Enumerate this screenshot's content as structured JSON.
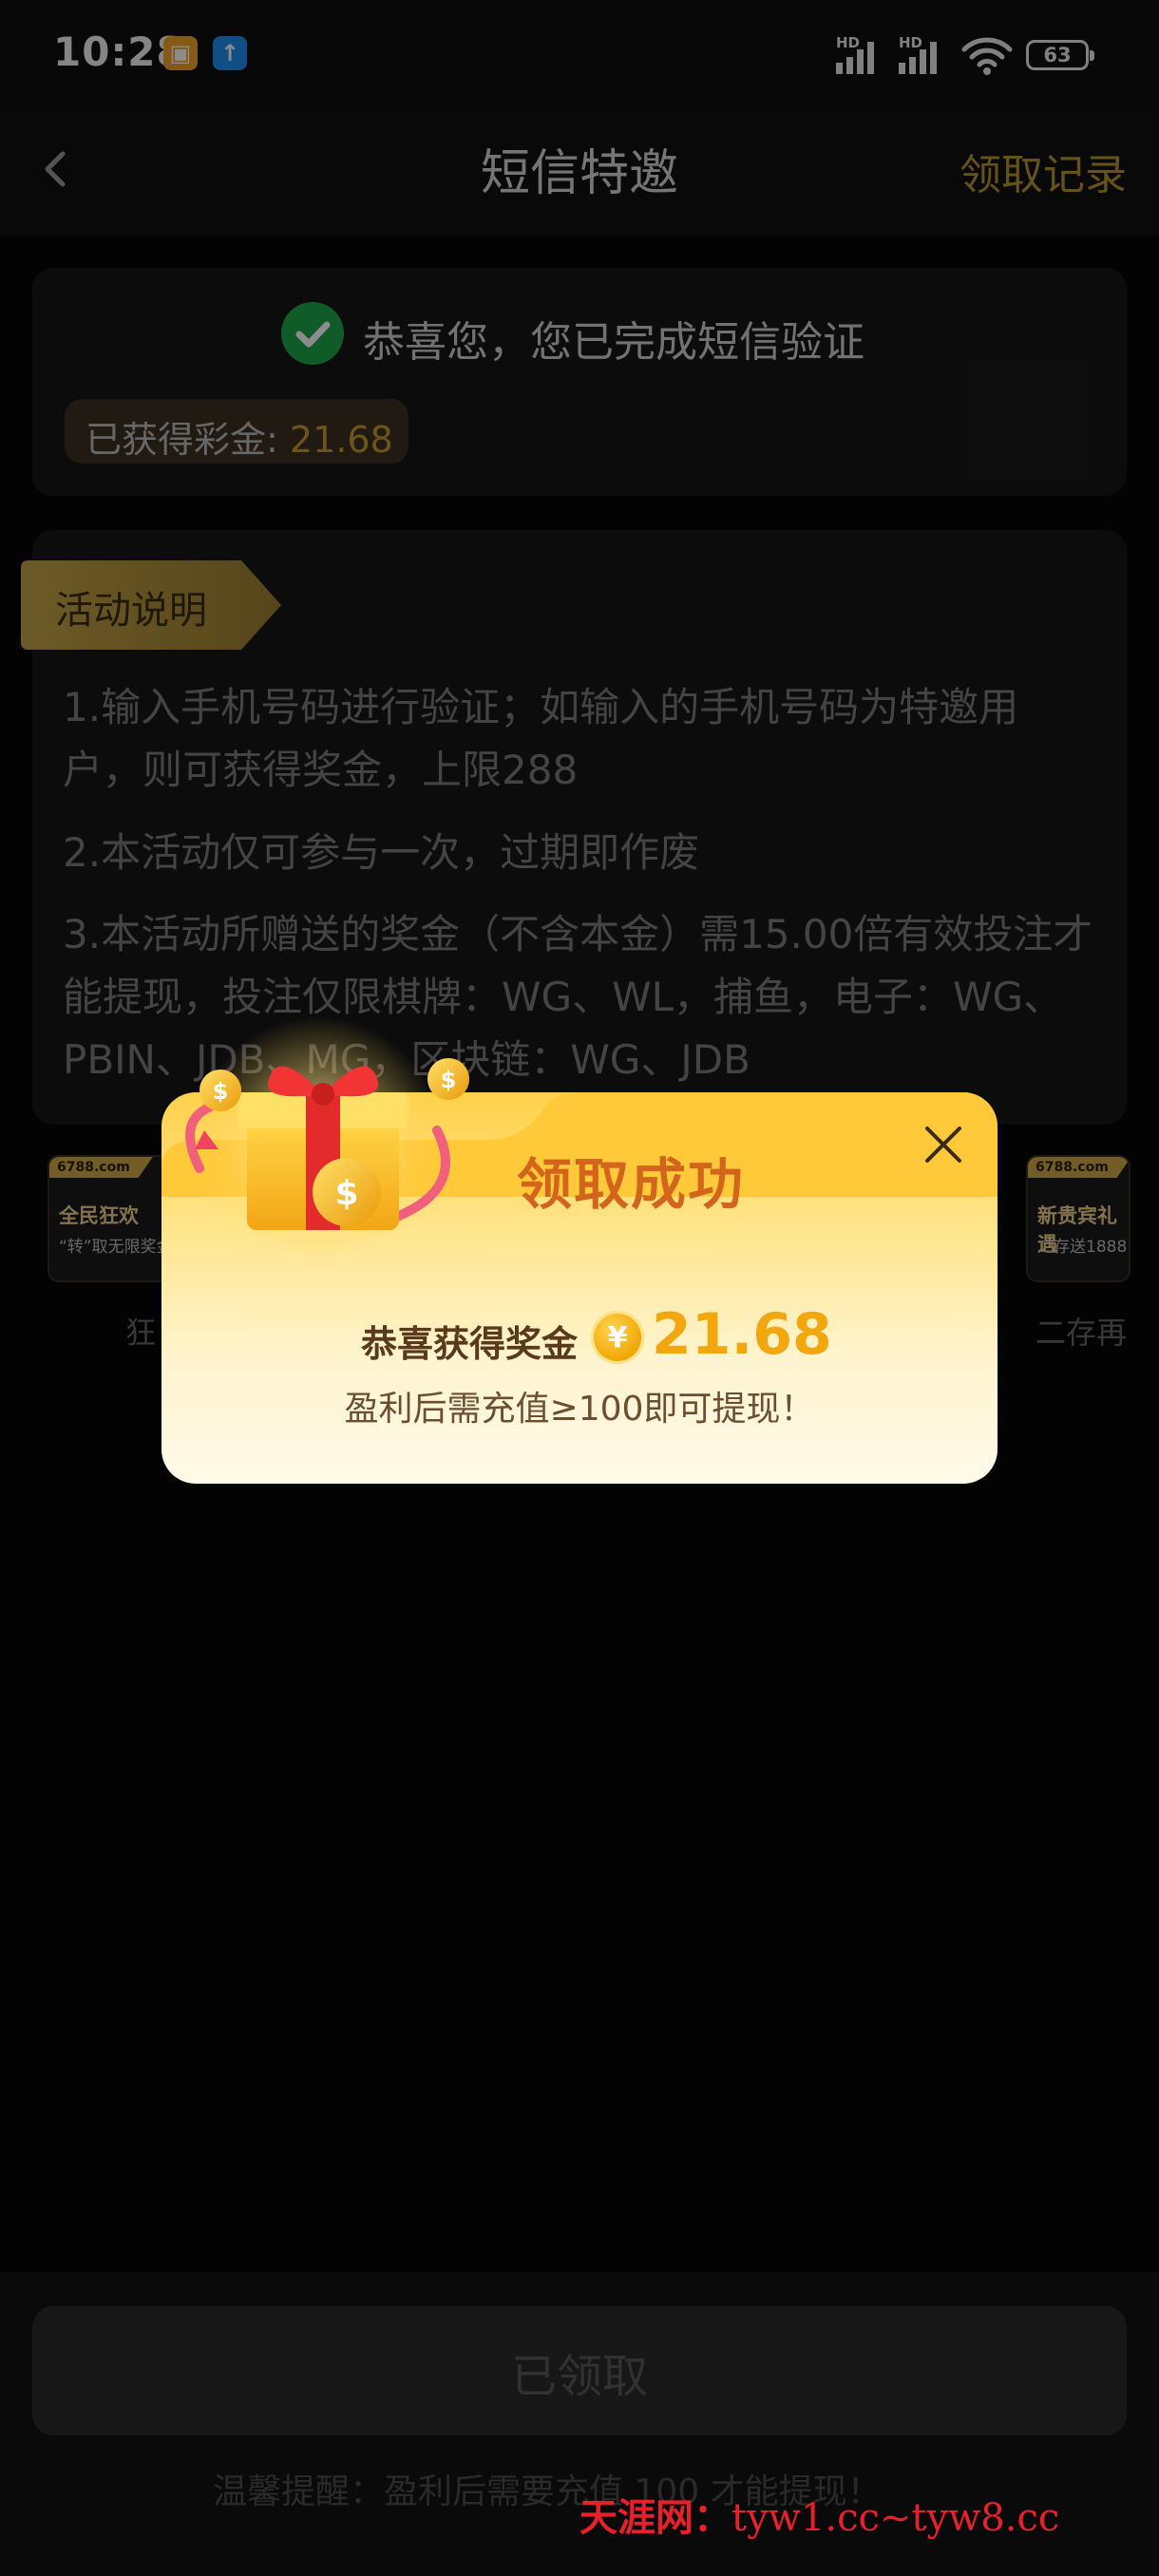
{
  "status_bar": {
    "time": "10:28",
    "signal_label": "HD",
    "battery": "63"
  },
  "header": {
    "title": "短信特邀",
    "records_label": "领取记录"
  },
  "verification": {
    "message": "恭喜您，您已完成短信验证",
    "bonus_label": "已获得彩金: ",
    "bonus_value": "21.68"
  },
  "rules": {
    "tag": "活动说明",
    "items": [
      "1.输入手机号码进行验证；如输入的手机号码为特邀用户，则可获得奖金，上限288",
      "2.本活动仅可参与一次，过期即作废",
      "3.本活动所赠送的奖金（不含本金）需15.00倍有效投注才能提现，投注仅限棋牌：WG、WL，捕鱼，电子：WG、PBIN、JDB、MG，区块链：WG、JDB"
    ]
  },
  "banners": [
    {
      "site": "6788.com",
      "title": "全民狂欢",
      "subtitle": "“转”取无限奖金",
      "caption": "狂"
    },
    {
      "site": "6788.com",
      "title": "新贵宾礼遇",
      "subtitle": "二存送1888",
      "caption": "二存再"
    }
  ],
  "modal": {
    "title": "领取成功",
    "reward_label": "恭喜获得奖金",
    "coin_symbol": "¥",
    "reward_amount": "21.68",
    "note": "盈利后需充值≥100即可提现！"
  },
  "footer": {
    "button_label": "已领取",
    "tip": "温馨提醒：盈利后需要充值 100 才能提现！",
    "watermark_cn": "天涯网：",
    "watermark_url": "tyw1.cc~tyw8.cc"
  },
  "colors": {
    "accent_gold": "#c79b2e",
    "modal_title": "#d2651b",
    "check_green": "#1ea84a"
  }
}
